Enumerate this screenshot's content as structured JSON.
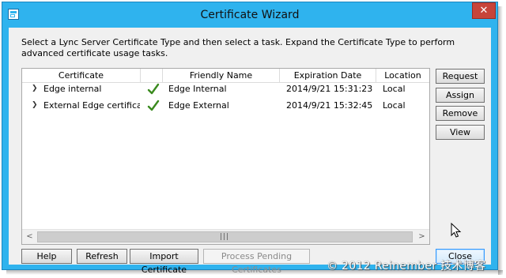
{
  "window": {
    "title": "Certificate Wizard",
    "close_label": "✕"
  },
  "instructions": "Select a Lync Server Certificate Type and then select a task. Expand the Certificate Type to perform advanced certificate usage tasks.",
  "table": {
    "columns": [
      "Certificate",
      "",
      "Friendly Name",
      "Expiration Date",
      "Location"
    ],
    "rows": [
      {
        "certificate": "Edge internal",
        "status_icon": "checkmark-icon",
        "friendly_name": "Edge Internal",
        "expiration_date": "2014/9/21 15:31:23",
        "location": "Local"
      },
      {
        "certificate": "External Edge certificate (",
        "status_icon": "checkmark-icon",
        "friendly_name": "Edge External",
        "expiration_date": "2014/9/21 15:32:45",
        "location": "Local"
      }
    ],
    "scroll_left_label": "<",
    "scroll_right_label": ">",
    "scroll_grip": "|||"
  },
  "side_buttons": {
    "request": "Request",
    "assign": "Assign",
    "remove": "Remove",
    "view": "View"
  },
  "bottom_buttons": {
    "help": "Help",
    "refresh": "Refresh",
    "import": "Import Certificate",
    "process": "Process Pending Certificates",
    "close": "Close"
  },
  "watermark": "© 2012 Reinember 技术博客",
  "colors": {
    "titlebar": "#2fb3ee",
    "close_button": "#c7443a",
    "checkmark": "#3a8a1e"
  }
}
